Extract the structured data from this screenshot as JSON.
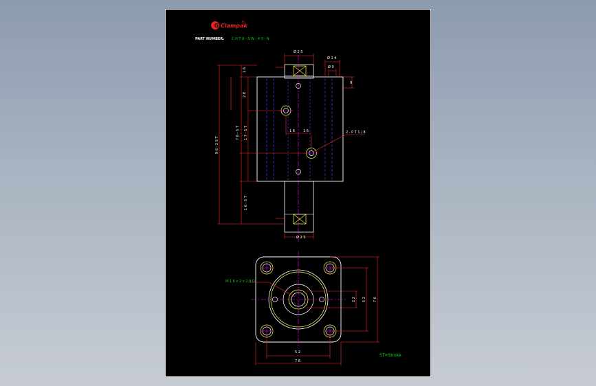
{
  "brand": {
    "name": "Clampak",
    "registered": "®",
    "logo_color": "#e8251f"
  },
  "header": {
    "part_number_label": "PART  NUMBER:",
    "part_number_value": "C H T 8 - S W - 4 0 - N"
  },
  "dimensions": {
    "top_bore": "Ø 2 5",
    "side_dia_1": "Ø 1 4",
    "side_dia_2": "Ø 9",
    "side_9": "9",
    "left_16": "1 6",
    "left_28": "2 8",
    "left_overall": "9 6 - 2 S T",
    "left_mid": "7 6 - S T",
    "left_mid2": "1 7 - S T",
    "left_lower": "1 6 - S T",
    "port_left_16": "1 6",
    "port_right_16": "1 6",
    "port_callout": "2 - P T 1 / 8",
    "bottom_bore": "Ø 2 5",
    "thread_callout": "M 1 6 x 2 x 2 0 D",
    "right_22": "2 2",
    "right_52": "5 2",
    "right_76": "7 6",
    "bottom_52": "5 2",
    "bottom_76": "7 6"
  },
  "legend": {
    "stroke_note": "ST=Stroke"
  },
  "colors": {
    "background": "#000000",
    "outline": "#ffffff",
    "dimension": "#ff2a2a",
    "text": "#ffffff",
    "hidden": "#3b3bff",
    "center": "#ff00ff",
    "green": "#00e000",
    "yellow": "#ffff40"
  }
}
